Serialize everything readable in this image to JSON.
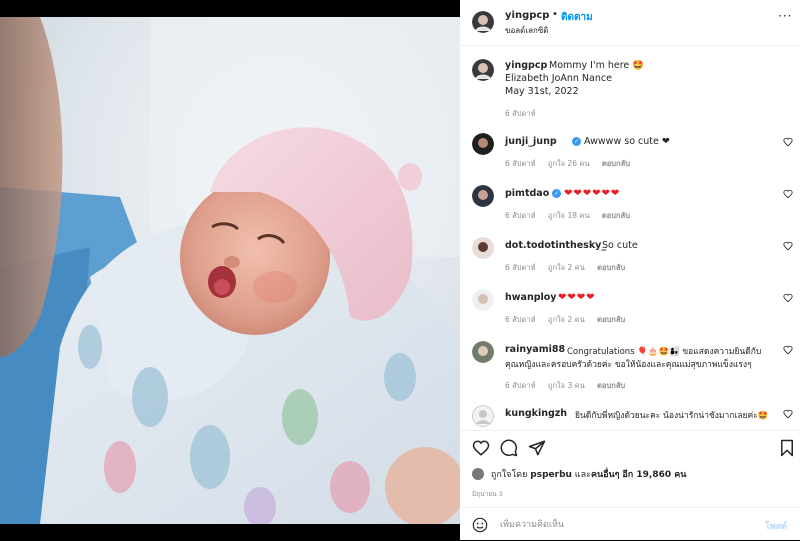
{
  "post_header": {
    "username": "yingpcp",
    "separator": "•",
    "follow_label": "ติดตาม",
    "subtitle": "ขอลด์เลกซิดิ",
    "more_label": "···"
  },
  "caption": {
    "username": "yingpcp",
    "line1": "Mommy I'm here 🤩",
    "line2": "Elizabeth JoAnn Nance",
    "line3": "May 31st, 2022",
    "time": "6 สัปดาห์"
  },
  "comments": [
    {
      "user": "junji_junp",
      "verified": true,
      "text": "Awwww so cute ❤",
      "time": "6 สัปดาห์",
      "likes": "ถูกใจ 26 คน",
      "reply": "ตอบกลับ"
    },
    {
      "user": "pimtdao",
      "verified": true,
      "text": "❤❤❤❤❤❤",
      "time": "6 สัปดาห์",
      "likes": "ถูกใจ 18 คน",
      "reply": "ตอบกลับ"
    },
    {
      "user": "dot.todotinthesky_",
      "verified": false,
      "text": "So cute",
      "time": "6 สัปดาห์",
      "likes": "ถูกใจ 2 คน",
      "reply": "ตอบกลับ"
    },
    {
      "user": "hwanploy",
      "verified": false,
      "text": "❤❤❤❤",
      "time": "6 สัปดาห์",
      "likes": "ถูกใจ 2 คน",
      "reply": "ตอบกลับ"
    },
    {
      "user": "rainyami88",
      "verified": false,
      "text": "Congratulations 🎈🎂🤩👩‍👧 ขอแสดงความยินดีกับ",
      "text2": "คุณหญิงและครอบครัวด้วยค่ะ ขอให้น้องและคุณแม่สุขภาพแข็งแรงๆ",
      "time": "6 สัปดาห์",
      "likes": "ถูกใจ 3 คน",
      "reply": "ตอบกลับ"
    },
    {
      "user": "kungkingzh",
      "verified": false,
      "text": "ยินดีกับพี่หญิงด้วยนะคะ น้องน่ารักน่าชังมากเลยค่ะ🤩",
      "time": "",
      "likes": "",
      "reply": ""
    }
  ],
  "actions": {
    "like_icon": "heart-icon",
    "comment_icon": "comment-icon",
    "share_icon": "share-icon",
    "save_icon": "bookmark-icon",
    "liked_by_prefix": "ถูกใจโดย",
    "liked_by_user": "psperbu",
    "liked_by_and": "และ",
    "liked_by_others": "คนอื่นๆ",
    "liked_by_count": "อีก 19,860 คน",
    "date": "มิถุนายน 3"
  },
  "comment_box": {
    "placeholder": "เพิ่มความคิดเห็น",
    "post_label": "โพสต์"
  },
  "colors": {
    "link_blue": "#0095f6",
    "verified_blue": "#3897f0",
    "heart_red": "#ed1c24",
    "muted": "#8e8e8e"
  }
}
